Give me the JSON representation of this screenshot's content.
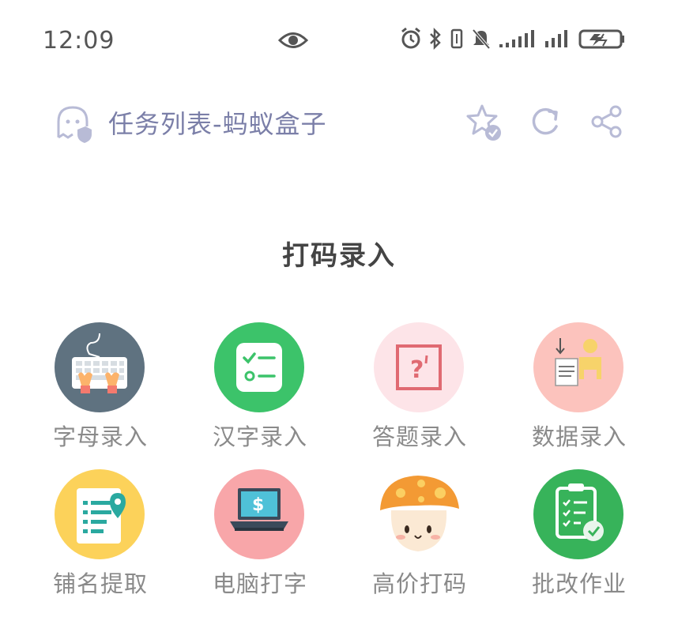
{
  "status_bar": {
    "time": "12:09",
    "icons": [
      "eye-icon",
      "alarm-icon",
      "bluetooth-icon",
      "vibrate-icon",
      "mute-icon",
      "signal-icon",
      "signal-icon",
      "battery-icon"
    ]
  },
  "header": {
    "title": "任务列表-蚂蚁盒子",
    "actions": [
      "star-icon",
      "refresh-icon",
      "share-icon"
    ]
  },
  "section": {
    "title": "打码录入"
  },
  "tiles": [
    {
      "label": "字母录入",
      "icon": "keyboard-icon",
      "color": "#5f7280"
    },
    {
      "label": "汉字录入",
      "icon": "checklist-icon",
      "color": "#3cc36a"
    },
    {
      "label": "答题录入",
      "icon": "question-icon",
      "color": "#fde4e8"
    },
    {
      "label": "数据录入",
      "icon": "document-person-icon",
      "color": "#fcc3bd"
    },
    {
      "label": "铺名提取",
      "icon": "location-list-icon",
      "color": "#fcd25a"
    },
    {
      "label": "电脑打字",
      "icon": "laptop-icon",
      "color": "#f8a6a9"
    },
    {
      "label": "高价打码",
      "icon": "mushroom-icon",
      "color": "#ffffff"
    },
    {
      "label": "批改作业",
      "icon": "clipboard-check-icon",
      "color": "#37b35a"
    }
  ]
}
